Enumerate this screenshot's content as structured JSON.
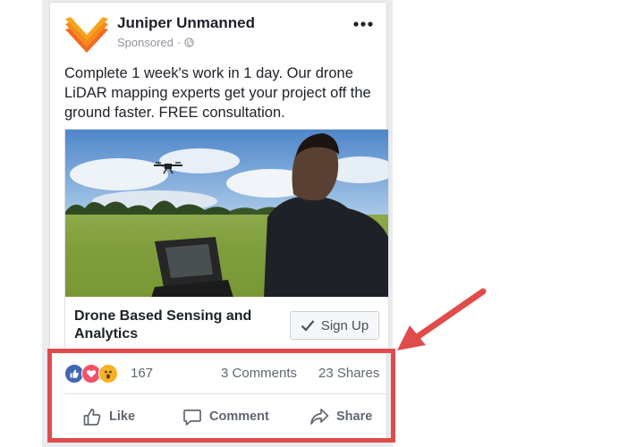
{
  "post": {
    "page_name": "Juniper Unmanned",
    "sponsored_label": "Sponsored",
    "more_icon": "more-horizontal-icon",
    "text": "Complete 1 week's work in 1 day. Our drone LiDAR mapping experts get your project off the ground faster. FREE consultation."
  },
  "link": {
    "title": "Drone Based Sensing and Analytics",
    "cta_label": "Sign Up"
  },
  "stats": {
    "reaction_count": "167",
    "comments": "3 Comments",
    "shares": "23 Shares"
  },
  "actions": {
    "like": "Like",
    "comment": "Comment",
    "share": "Share"
  },
  "colors": {
    "annotation_red": "#e04b4b",
    "logo_orange": "#f26b21",
    "logo_yellow": "#f9a21b",
    "like_blue": "#4267b2",
    "love_red": "#f25268",
    "wow_yellow": "#f7b125"
  }
}
